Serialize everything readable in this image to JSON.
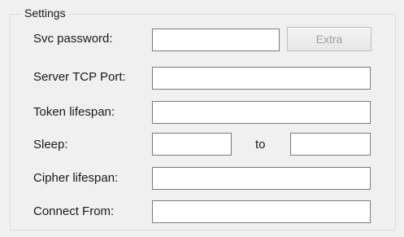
{
  "group": {
    "title": "Settings"
  },
  "fields": {
    "svc_password": {
      "label": "Svc password:",
      "value": ""
    },
    "server_tcp_port": {
      "label": "Server TCP Port:",
      "value": ""
    },
    "token_lifespan": {
      "label": "Token lifespan:",
      "value": ""
    },
    "sleep": {
      "label": "Sleep:",
      "from_value": "",
      "to_label": "to",
      "to_value": ""
    },
    "cipher_lifespan": {
      "label": "Cipher lifespan:",
      "value": ""
    },
    "connect_from": {
      "label": "Connect From:",
      "value": ""
    }
  },
  "buttons": {
    "extra": {
      "label": "Extra",
      "state": "disabled"
    }
  },
  "colors": {
    "window_bg": "#f0f0f0",
    "groupbox_border": "#d5dfe5",
    "input_border": "#7a7a7a",
    "disabled_text": "#a0a0a0"
  }
}
